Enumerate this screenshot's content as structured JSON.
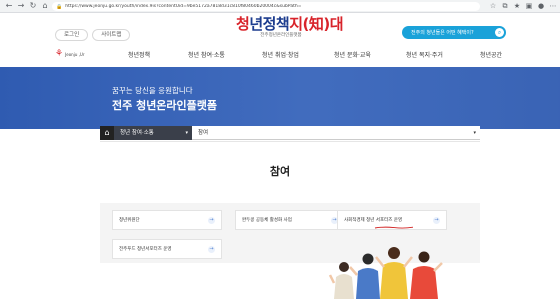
{
  "browser": {
    "url": "https://www.jeonju.go.kr/youth/index.9is?contentUid=9be5172a7818d31c810f80460b20004c&subPath="
  },
  "header": {
    "login_label": "로그인",
    "sitemap_label": "사이트맵",
    "brand_title_1": "청",
    "brand_title_2": "년정책",
    "brand_title_3": "지(知)대",
    "brand_subtitle": "전주청년온라인플랫폼",
    "search_label": "전주의 청년들은 어떤 혜택이?",
    "logo_mark": "⚘",
    "logo_text": "Jeonju ,Ur",
    "nav": [
      {
        "label": "청년정책"
      },
      {
        "label": "청년 참여·소통"
      },
      {
        "label": "청년 취업·창업"
      },
      {
        "label": "청년 문화·교육"
      },
      {
        "label": "청년 복지·주거"
      },
      {
        "label": "청년공간"
      }
    ]
  },
  "hero": {
    "subtitle": "꿈꾸는 당신을 응원합니다",
    "title": "전주 청년온라인플랫폼"
  },
  "breadcrumb": {
    "home_icon": "home-icon",
    "level1": "청년 참여·소통",
    "level2": "참여"
  },
  "main": {
    "section_title": "참여",
    "cards": [
      {
        "label": "청년위원단"
      },
      {
        "label": "완두콩 공동체 활성화 사업"
      },
      {
        "label": "사회적경제 청년 서포터즈 운영"
      },
      {
        "label": "전주푸드 청년서포터즈 운영"
      }
    ]
  },
  "colors": {
    "hero_blue": "#2f5bb1",
    "brand_red": "#d8232a",
    "brand_navy": "#1d3d8f",
    "search_blue": "#1aa2d9",
    "annotation_red": "#d11f1f"
  }
}
